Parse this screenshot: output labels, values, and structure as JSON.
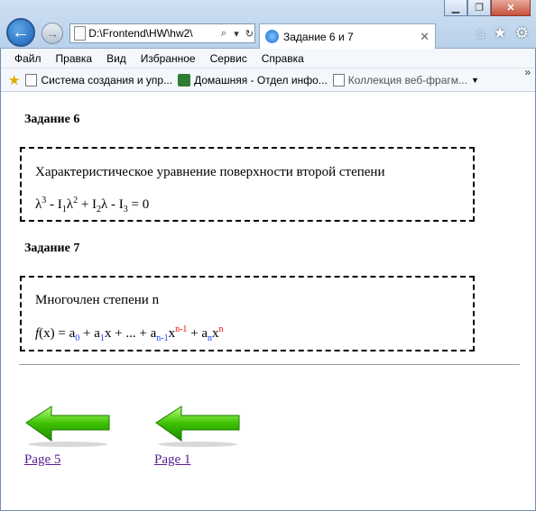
{
  "browser": {
    "address": "D:\\Frontend\\HW\\hw2\\",
    "tab_title": "Задание 6 и 7",
    "window_controls": {
      "minimize": "▁",
      "restore": "❐",
      "close": "✕"
    },
    "toolbar_icons": [
      "home-icon",
      "star-icon",
      "gear-icon"
    ]
  },
  "menu": [
    "Файл",
    "Правка",
    "Вид",
    "Избранное",
    "Сервис",
    "Справка"
  ],
  "favorites": [
    {
      "label": "Система создания и упр..."
    },
    {
      "label": "Домашняя - Отдел инфо..."
    },
    {
      "label": "Коллекция веб-фрагм..."
    }
  ],
  "page": {
    "task6": {
      "heading": "Задание 6",
      "text": "Характеристическое уравнение поверхности второй степени"
    },
    "task7": {
      "heading": "Задание 7",
      "text": "Многочлен степени n"
    },
    "links": [
      {
        "label": "Page 5"
      },
      {
        "label": "Page 1"
      }
    ]
  }
}
